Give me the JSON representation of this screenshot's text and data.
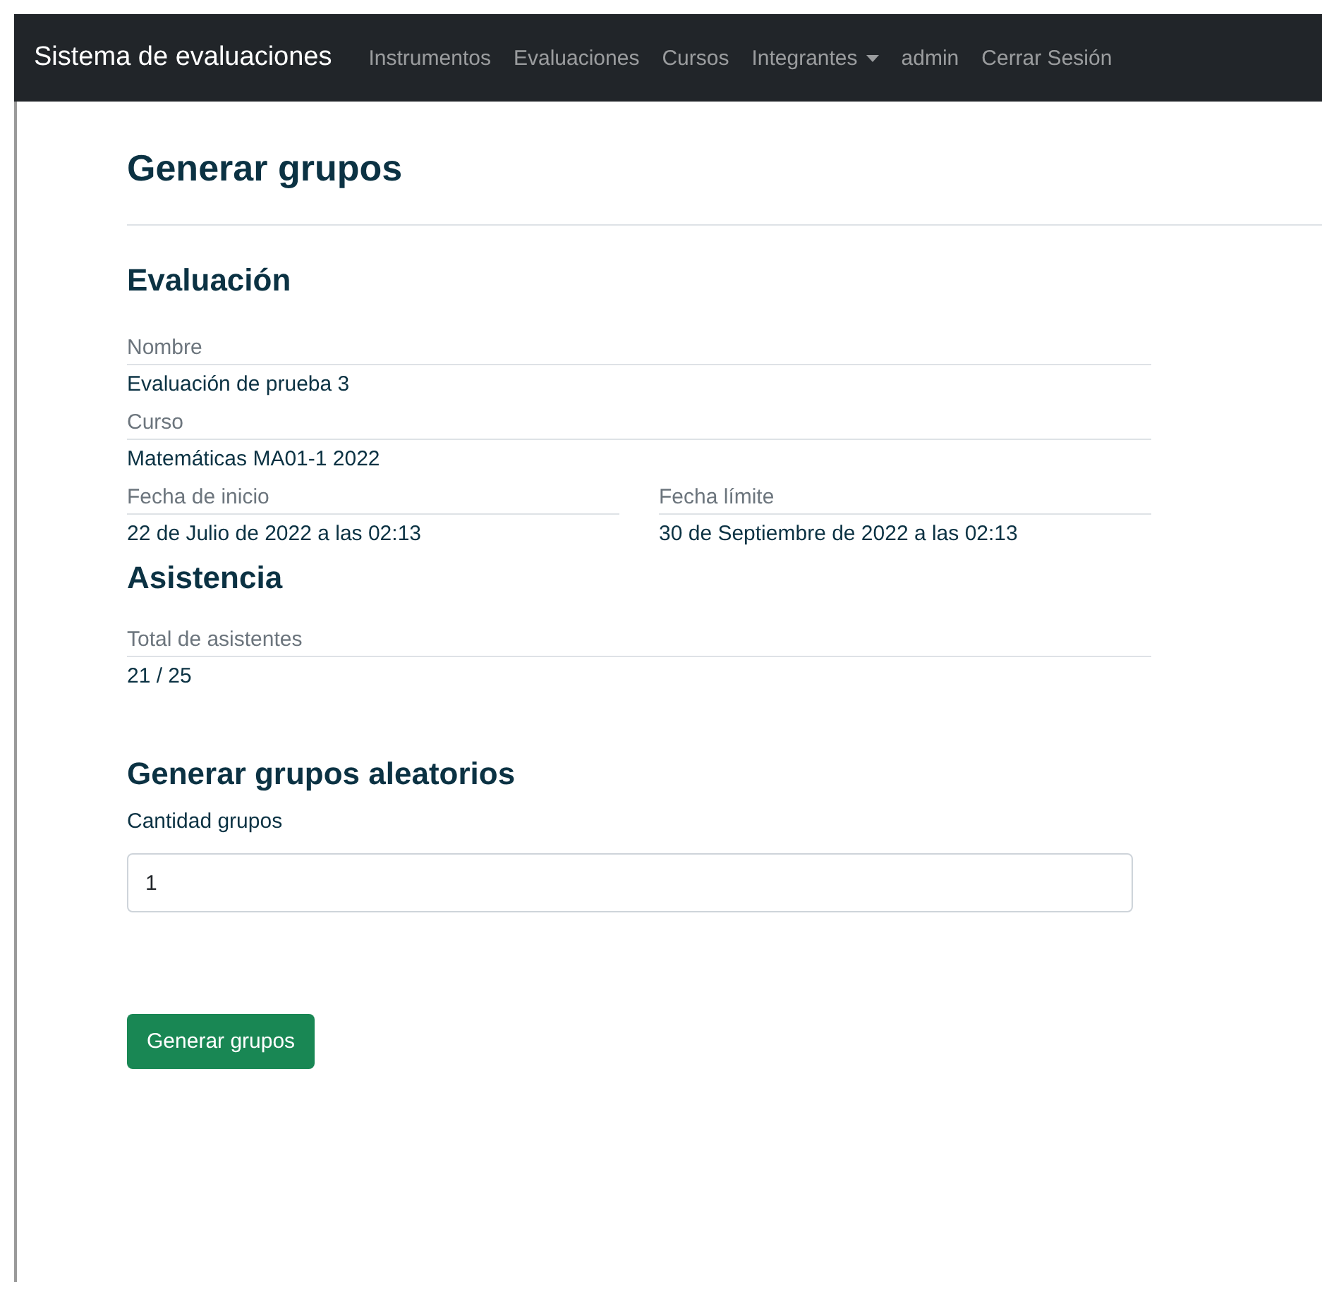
{
  "navbar": {
    "brand": "Sistema de evaluaciones",
    "items": [
      {
        "label": "Instrumentos",
        "kind": "link"
      },
      {
        "label": "Evaluaciones",
        "kind": "link"
      },
      {
        "label": "Cursos",
        "kind": "link"
      },
      {
        "label": "Integrantes",
        "kind": "dropdown"
      },
      {
        "label": "admin",
        "kind": "link"
      },
      {
        "label": "Cerrar Sesión",
        "kind": "link"
      }
    ]
  },
  "page_title": "Generar grupos",
  "sections": [
    {
      "heading": "Evaluación",
      "rows": [
        [
          {
            "label": "Nombre",
            "value": "Evaluación de prueba 3"
          }
        ],
        [
          {
            "label": "Curso",
            "value": "Matemáticas MA01-1 2022"
          }
        ],
        [
          {
            "label": "Fecha de inicio",
            "value": "22 de Julio de 2022 a las 02:13"
          },
          {
            "label": "Fecha límite",
            "value": "30 de Septiembre de 2022 a las 02:13"
          }
        ]
      ]
    },
    {
      "heading": "Asistencia",
      "rows": [
        [
          {
            "label": "Total de asistentes",
            "value": "21 / 25"
          }
        ]
      ]
    }
  ],
  "form": {
    "heading": "Generar grupos aleatorios",
    "field_label": "Cantidad grupos",
    "value": "1",
    "submit": "Generar grupos"
  }
}
